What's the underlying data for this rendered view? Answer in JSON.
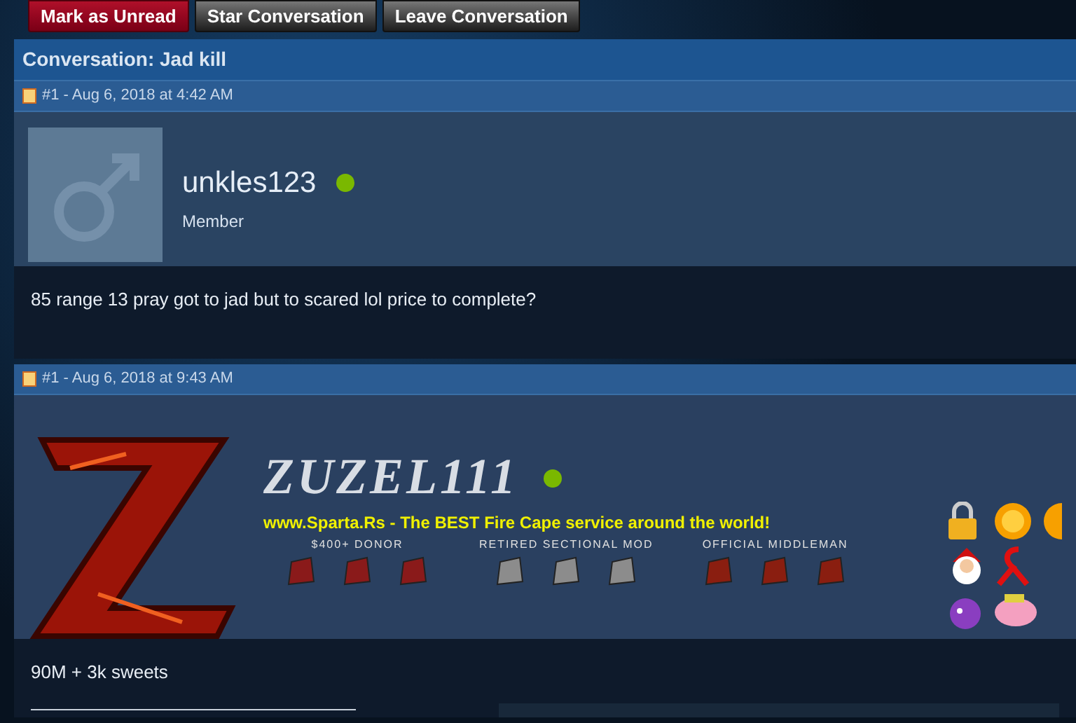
{
  "buttons": [
    {
      "label": "Mark as Unread",
      "kind": "primary"
    },
    {
      "label": "Star Conversation",
      "kind": "secondary"
    },
    {
      "label": "Leave Conversation",
      "kind": "secondary"
    }
  ],
  "title": "Conversation: Jad kill",
  "posts": [
    {
      "header": "#1 - Aug 6, 2018 at 4:42 AM",
      "kind": "plain",
      "username": "unkles123",
      "online": true,
      "role": "Member",
      "message": "85 range 13 pray got to jad but to scared lol price to complete?"
    },
    {
      "header": "#1 - Aug 6, 2018 at 9:43 AM",
      "kind": "banner",
      "username": "ZUZEL111",
      "online": true,
      "tagline": "www.Sparta.Rs - The BEST Fire Cape service around the world!",
      "badge_groups": [
        "$400+ DONOR",
        "RETIRED SECTIONAL MOD",
        "OFFICIAL MIDDLEMAN"
      ],
      "message": "90M + 3k sweets"
    }
  ]
}
